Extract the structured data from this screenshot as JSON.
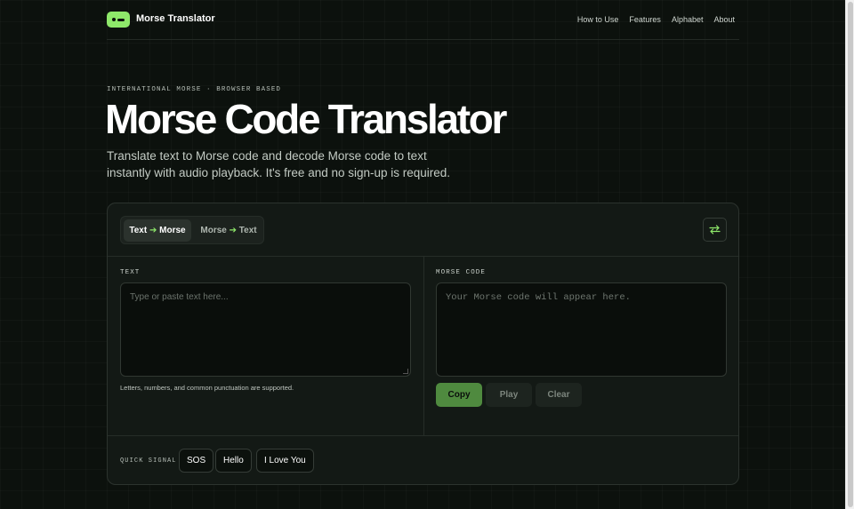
{
  "brand": {
    "name": "Morse Translator"
  },
  "nav": {
    "links": [
      "How to Use",
      "Features",
      "Alphabet",
      "About"
    ]
  },
  "hero": {
    "eyebrow": "INTERNATIONAL MORSE · BROWSER BASED",
    "title": "Morse Code Translator",
    "subtitle": "Translate text to Morse code and decode Morse code to text instantly with audio playback. It's free and no sign-up is required."
  },
  "translator": {
    "modes": [
      {
        "from": "Text",
        "to": "Morse",
        "active": true
      },
      {
        "from": "Morse",
        "to": "Text",
        "active": false
      }
    ],
    "swap_icon": "swap-arrows-icon",
    "input": {
      "label": "TEXT",
      "placeholder": "Type or paste text here...",
      "hint": "Letters, numbers, and common punctuation are supported."
    },
    "output": {
      "label": "MORSE CODE",
      "placeholder": "Your Morse code will appear here."
    },
    "actions": {
      "copy": "Copy",
      "play": "Play",
      "clear": "Clear"
    },
    "quick": {
      "label": "QUICK SIGNAL",
      "chips": [
        "SOS",
        "Hello",
        "I Love You"
      ]
    }
  },
  "colors": {
    "accent": "#8ee86a",
    "copy_button": "#4f8a3f",
    "background": "#0c110d"
  }
}
